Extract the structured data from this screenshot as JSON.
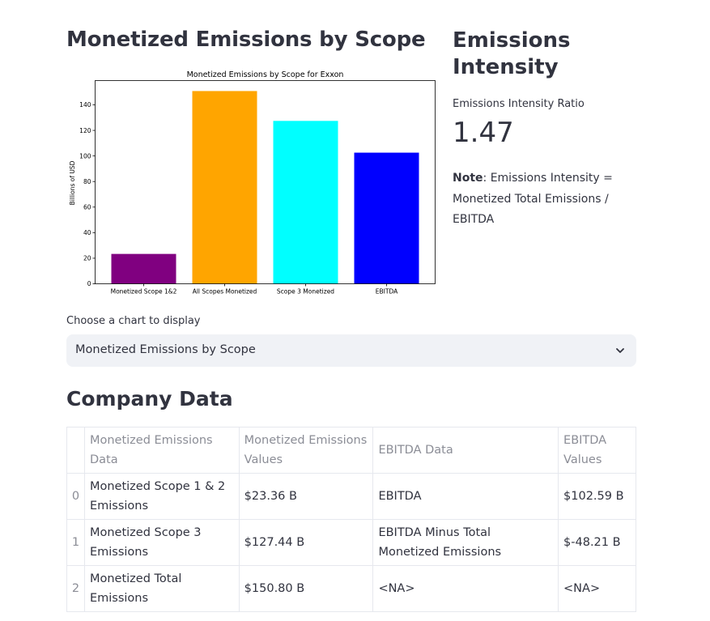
{
  "left_title": "Monetized Emissions by Scope",
  "right_title": "Emissions Intensity",
  "chart_data": {
    "type": "bar",
    "title": "Monetized Emissions by Scope for Exxon",
    "xlabel": "",
    "ylabel": "Billions of USD",
    "categories": [
      "Monetized Scope 1&2",
      "All Scopes Monetized",
      "Scope 3 Monetized",
      "EBITDA"
    ],
    "values": [
      23.36,
      150.8,
      127.44,
      102.59
    ],
    "colors": [
      "#800080",
      "#ffa500",
      "#00ffff",
      "#0000ff"
    ],
    "ylim": [
      0,
      159
    ],
    "yticks": [
      0,
      20,
      40,
      60,
      80,
      100,
      120,
      140
    ],
    "grid": false
  },
  "metric": {
    "label": "Emissions Intensity Ratio",
    "value": "1.47"
  },
  "note": {
    "bold": "Note",
    "text": ": Emissions Intensity = Monetized Total Emissions / EBITDA"
  },
  "selector": {
    "label": "Choose a chart to display",
    "value": "Monetized Emissions by Scope"
  },
  "company_title": "Company Data",
  "table": {
    "headers": [
      "",
      "Monetized Emissions Data",
      "Monetized Emissions Values",
      "EBITDA Data",
      "EBITDA Values"
    ],
    "rows": [
      [
        "0",
        "Monetized Scope 1 & 2 Emissions",
        "$23.36 B",
        "EBITDA",
        "$102.59 B"
      ],
      [
        "1",
        "Monetized Scope 3 Emissions",
        "$127.44 B",
        "EBITDA Minus Total Monetized Emissions",
        "$-48.21 B"
      ],
      [
        "2",
        "Monetized Total Emissions",
        "$150.80 B",
        "<NA>",
        "<NA>"
      ]
    ]
  }
}
